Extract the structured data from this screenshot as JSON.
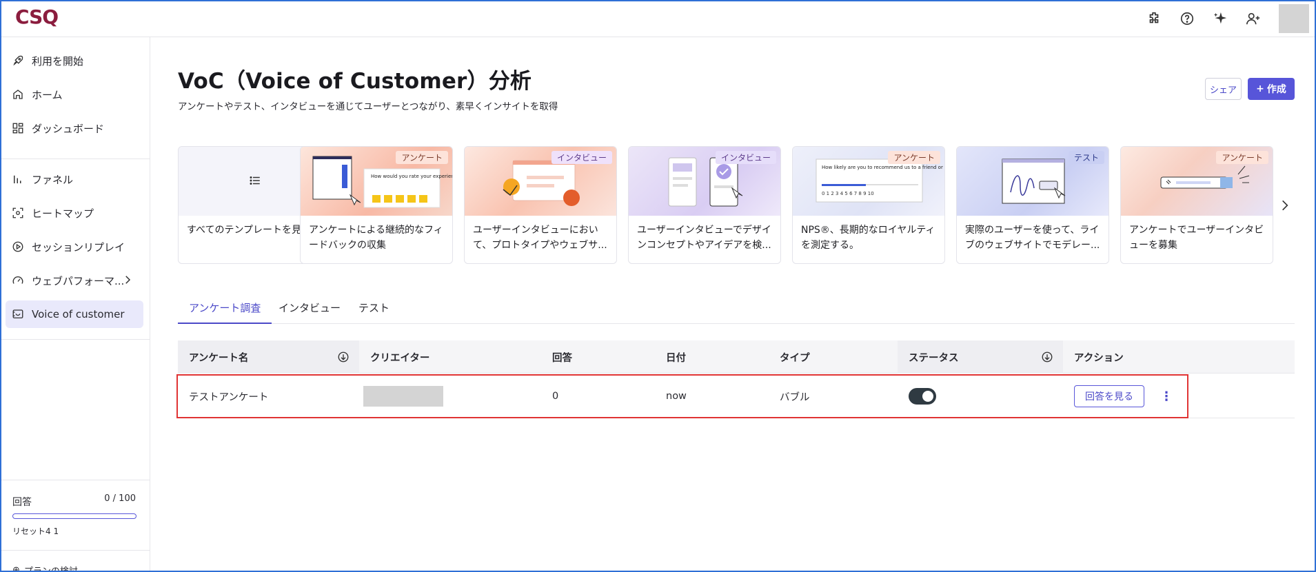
{
  "app": {
    "logo_text": "CSQ"
  },
  "topbar": {
    "icons": [
      "puzzle-icon",
      "help-icon",
      "sparkle-icon",
      "add-user-icon"
    ]
  },
  "sidebar": {
    "items": [
      {
        "label": "利用を開始",
        "icon": "rocket-icon"
      },
      {
        "label": "ホーム",
        "icon": "home-icon"
      },
      {
        "label": "ダッシュボード",
        "icon": "dashboard-icon"
      },
      {
        "label": "ファネル",
        "icon": "funnel-icon"
      },
      {
        "label": "ヒートマップ",
        "icon": "heatmap-icon"
      },
      {
        "label": "セッションリプレイ",
        "icon": "play-icon"
      },
      {
        "label": "ウェブパフォーマ...",
        "icon": "gauge-icon"
      },
      {
        "label": "Voice of customer",
        "icon": "voc-icon",
        "active": true
      }
    ],
    "quota": {
      "label": "回答",
      "count": "0 / 100",
      "fraction": 0.0,
      "reset": "リセット4 1"
    },
    "plan_link": "プランの検討"
  },
  "header": {
    "title": "VoC（Voice of Customer）分析",
    "subtitle": "アンケートやテスト、インタビューを通じてユーザーとつながり、素早くインサイトを取得",
    "share_label": "シェア",
    "create_label": "作成"
  },
  "templates": [
    {
      "tag": "",
      "text": "すべてのテンプレートを見る",
      "icon": "list-icon"
    },
    {
      "tag": "アンケート",
      "text": "アンケートによる継続的なフィードバックの収集"
    },
    {
      "tag": "インタビュー",
      "text": "ユーザーインタビューにおいて、プロトタイプやウェブサ..."
    },
    {
      "tag": "インタビュー",
      "text": "ユーザーインタビューでデザインコンセプトやアイデアを検..."
    },
    {
      "tag": "アンケート",
      "text": "NPS®、長期的なロイヤルティを測定する。"
    },
    {
      "tag": "テスト",
      "text": "実際のユーザーを使って、ライブのウェブサイトでモデレー..."
    },
    {
      "tag": "アンケート",
      "text": "アンケートでユーザーインタビューを募集"
    }
  ],
  "template_thumb_texts": {
    "rate_question": "How would you rate your experience?",
    "nps_question": "How likely are you to recommend us to a friend or colleague?",
    "nps_scale": "0 1 2 3 4 5 6 7 8 9 10"
  },
  "tabs": [
    {
      "label": "アンケート調査",
      "active": true
    },
    {
      "label": "インタビュー"
    },
    {
      "label": "テスト"
    }
  ],
  "table": {
    "columns": [
      "アンケート名",
      "クリエイター",
      "回答",
      "日付",
      "タイプ",
      "ステータス",
      "アクション"
    ],
    "rows": [
      {
        "name": "テストアンケート",
        "responses": "0",
        "date": "now",
        "type": "バブル",
        "status_on": true,
        "action_label": "回答を見る"
      }
    ]
  }
}
